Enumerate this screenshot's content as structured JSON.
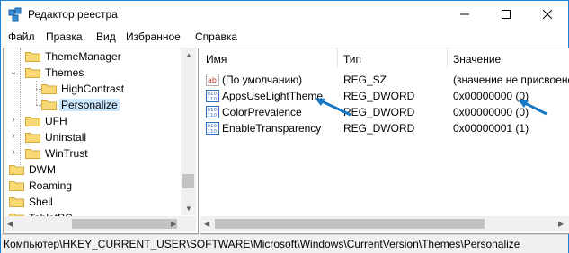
{
  "window": {
    "title": "Редактор реестра"
  },
  "menu": [
    "Файл",
    "Правка",
    "Вид",
    "Избранное",
    "Справка"
  ],
  "tree": {
    "items": [
      {
        "label": "ThemeManager",
        "selected": false
      },
      {
        "label": "Themes",
        "expanded": true,
        "selected": false
      },
      {
        "label": "HighContrast",
        "selected": false
      },
      {
        "label": "Personalize",
        "selected": true
      },
      {
        "label": "UFH",
        "selected": false
      },
      {
        "label": "Uninstall",
        "selected": false
      },
      {
        "label": "WinTrust",
        "selected": false
      },
      {
        "label": "DWM",
        "selected": false
      },
      {
        "label": "Roaming",
        "selected": false
      },
      {
        "label": "Shell",
        "selected": false
      },
      {
        "label": "TabletPC",
        "selected": false
      }
    ]
  },
  "list": {
    "columns": [
      "Имя",
      "Тип",
      "Значение"
    ],
    "rows": [
      {
        "icon": "string-value-icon",
        "name": "(По умолчанию)",
        "type": "REG_SZ",
        "value": "(значение не присвоено)"
      },
      {
        "icon": "binary-value-icon",
        "name": "AppsUseLightTheme",
        "type": "REG_DWORD",
        "value": "0x00000000 (0)"
      },
      {
        "icon": "binary-value-icon",
        "name": "ColorPrevalence",
        "type": "REG_DWORD",
        "value": "0x00000000 (0)"
      },
      {
        "icon": "binary-value-icon",
        "name": "EnableTransparency",
        "type": "REG_DWORD",
        "value": "0x00000001 (1)"
      }
    ]
  },
  "status": {
    "path": "Компьютер\\HKEY_CURRENT_USER\\SOFTWARE\\Microsoft\\Windows\\CurrentVersion\\Themes\\Personalize"
  },
  "colors": {
    "selection": "#cce8ff",
    "accent_border": "#1883d7",
    "annotation_arrow": "#1a78c2",
    "folder": "#f8d775"
  }
}
